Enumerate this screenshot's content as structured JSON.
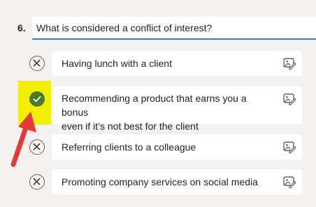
{
  "question": {
    "number": "6.",
    "text": "What is considered a conflict of interest?"
  },
  "options": [
    {
      "text": "Having lunch with a client",
      "status": "wrong",
      "status_icon": "x-circle-icon"
    },
    {
      "text_line1": "Recommending a product that earns you a bonus",
      "text_line2": "even if it’s not best for the client",
      "status": "correct",
      "status_icon": "check-circle-icon"
    },
    {
      "text": "Referring clients to a colleague",
      "status": "wrong",
      "status_icon": "x-circle-icon"
    },
    {
      "text": "Promoting company services on social media",
      "status": "wrong",
      "status_icon": "x-circle-icon"
    }
  ],
  "option_action_icon": "edit-image-icon",
  "colors": {
    "accent_underline": "#4a6fd6",
    "correct_marker": "#4a7a2a",
    "highlight": "#f2ee0a",
    "arrow": "#e53935"
  }
}
